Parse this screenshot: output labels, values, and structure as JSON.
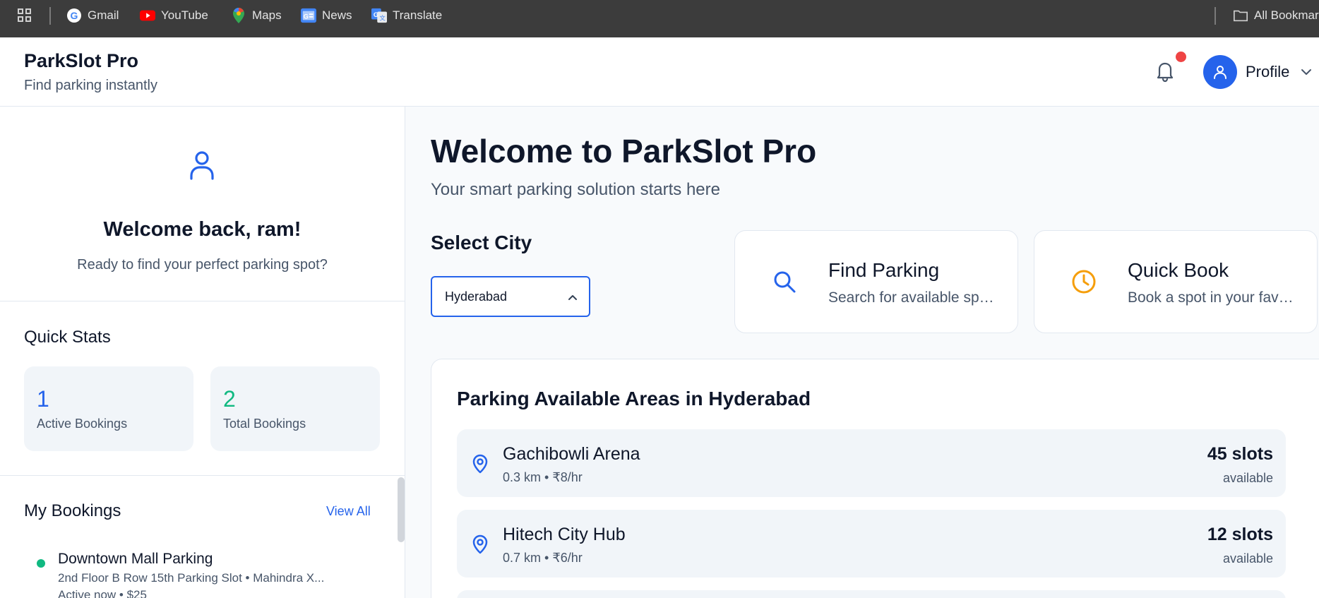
{
  "browser": {
    "bookmarks": [
      {
        "label": "Gmail",
        "icon": "google-icon"
      },
      {
        "label": "YouTube",
        "icon": "youtube-icon"
      },
      {
        "label": "Maps",
        "icon": "maps-icon"
      },
      {
        "label": "News",
        "icon": "news-icon"
      },
      {
        "label": "Translate",
        "icon": "translate-icon"
      }
    ],
    "all_bookmarks_label": "All Bookmarks"
  },
  "header": {
    "title": "ParkSlot Pro",
    "subtitle": "Find parking instantly",
    "profile_label": "Profile",
    "has_notification": true
  },
  "sidebar": {
    "welcome_title": "Welcome back, ram!",
    "welcome_subtitle": "Ready to find your perfect parking spot?",
    "stats_title": "Quick Stats",
    "stats": [
      {
        "value": "1",
        "label": "Active Bookings",
        "color": "#2563eb"
      },
      {
        "value": "2",
        "label": "Total Bookings",
        "color": "#10b981"
      }
    ],
    "bookings_title": "My Bookings",
    "view_all_label": "View All",
    "bookings": [
      {
        "name": "Downtown Mall Parking",
        "details": "2nd Floor B Row 15th Parking Slot • Mahindra X...",
        "status": "Active now • $25"
      }
    ]
  },
  "main": {
    "title": "Welcome to ParkSlot Pro",
    "subtitle": "Your smart parking solution starts here",
    "city_label": "Select City",
    "city_selected": "Hyderabad",
    "actions": [
      {
        "title": "Find Parking",
        "subtitle": "Search for available spots",
        "icon": "search-icon",
        "color": "#2563eb"
      },
      {
        "title": "Quick Book",
        "subtitle": "Book a spot in your favorite area",
        "icon": "clock-icon",
        "color": "#f59e0b"
      }
    ],
    "areas_title": "Parking Available Areas in Hyderabad",
    "areas": [
      {
        "name": "Gachibowli Arena",
        "meta": "0.3 km • ₹8/hr",
        "slots": "45 slots",
        "availability": "available"
      },
      {
        "name": "Hitech City Hub",
        "meta": "0.7 km • ₹6/hr",
        "slots": "12 slots",
        "availability": "available"
      }
    ]
  },
  "colors": {
    "primary": "#2563eb",
    "success": "#10b981",
    "warning": "#f59e0b",
    "notification": "#ef4444"
  }
}
